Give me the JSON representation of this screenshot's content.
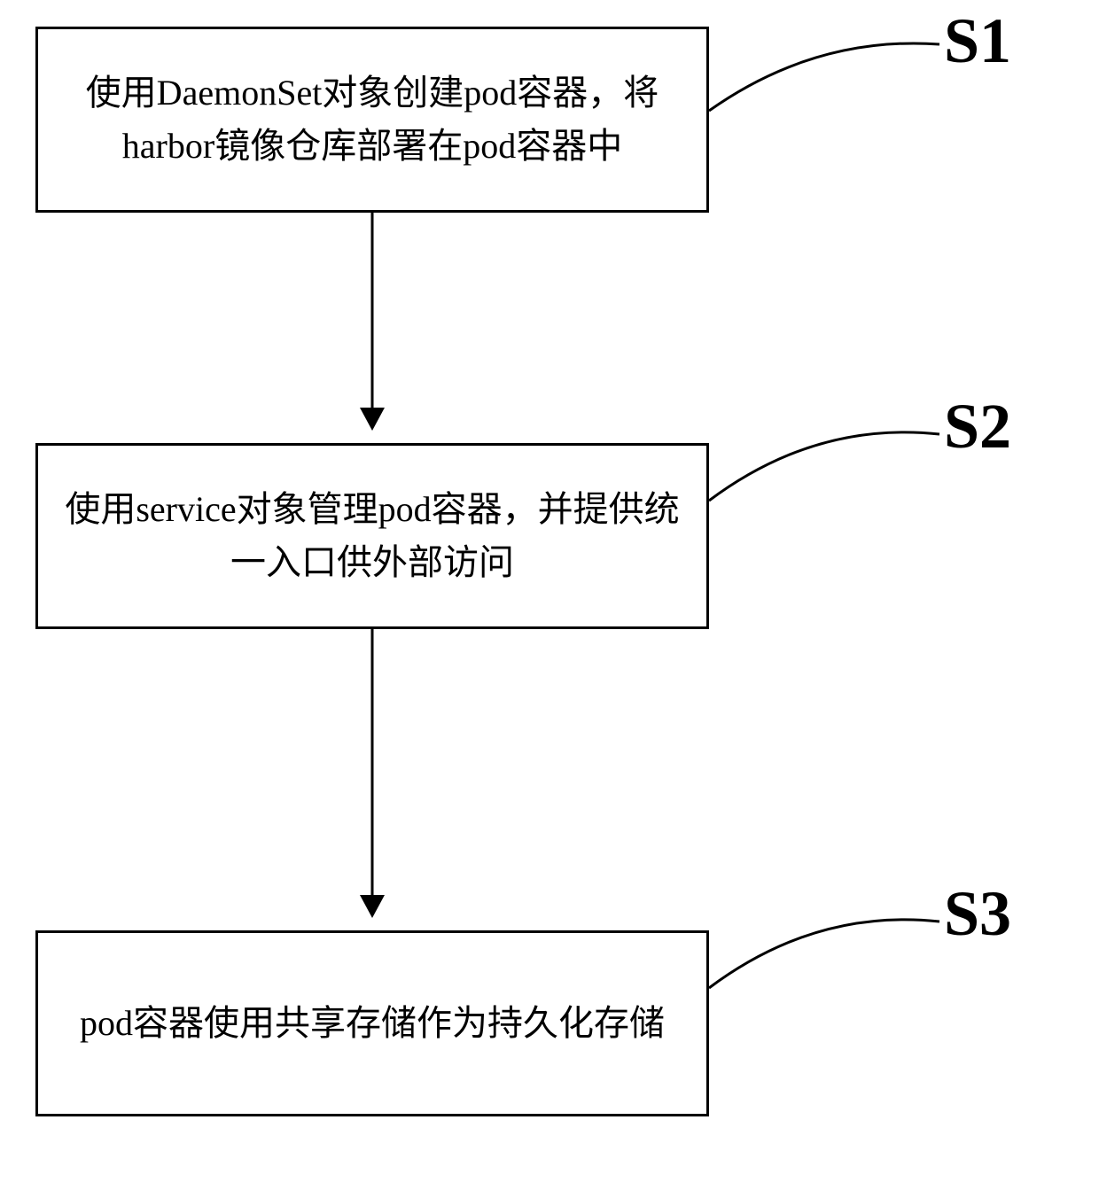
{
  "steps": [
    {
      "id": "S1",
      "text": "使用DaemonSet对象创建pod容器，将harbor镜像仓库部署在pod容器中"
    },
    {
      "id": "S2",
      "text": "使用service对象管理pod容器，并提供统一入口供外部访问"
    },
    {
      "id": "S3",
      "text": "pod容器使用共享存储作为持久化存储"
    }
  ]
}
